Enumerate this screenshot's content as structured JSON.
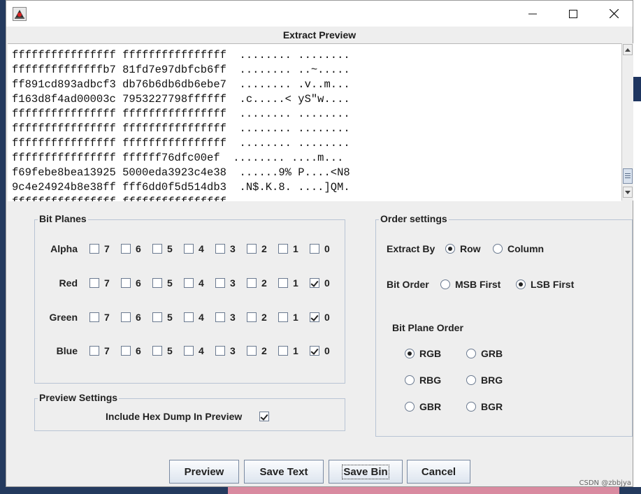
{
  "window": {
    "app_icon": "java-duke-icon",
    "controls": [
      "minimize-icon",
      "maximize-icon",
      "close-icon"
    ],
    "title": "Extract Preview"
  },
  "preview": {
    "lines": [
      "ffffffffffffffff ffffffffffffffff  ........ ........",
      "ffffffffffffffb7 81fd7e97dbfcb6ff  ........ ..~.....",
      "ff891cd893adbcf3 db76b6db6db6ebe7  ........ .v..m...",
      "f163d8f4ad00003c 7953227798ffffff  .c.....< yS\"w....",
      "ffffffffffffffff ffffffffffffffff  ........ ........",
      "ffffffffffffffff ffffffffffffffff  ........ ........",
      "ffffffffffffffff ffffffffffffffff  ........ ........",
      "ffffffffffffffff ffffff76dfc00ef  ........ ....m...",
      "f69febe8bea13925 5000eda3923c4e38  ......9% P....<N8",
      "9c4e24924b8e38ff fff6dd0f5d514db3  .N$.K.8. ....]QM.",
      "ffffffffffffffff ffffffffffffffff  ........ ........"
    ]
  },
  "bit_planes": {
    "title": "Bit Planes",
    "rows": [
      {
        "name": "Alpha",
        "bits": [
          {
            "label": "7",
            "checked": false
          },
          {
            "label": "6",
            "checked": false
          },
          {
            "label": "5",
            "checked": false
          },
          {
            "label": "4",
            "checked": false
          },
          {
            "label": "3",
            "checked": false
          },
          {
            "label": "2",
            "checked": false
          },
          {
            "label": "1",
            "checked": false
          },
          {
            "label": "0",
            "checked": false
          }
        ]
      },
      {
        "name": "Red",
        "bits": [
          {
            "label": "7",
            "checked": false
          },
          {
            "label": "6",
            "checked": false
          },
          {
            "label": "5",
            "checked": false
          },
          {
            "label": "4",
            "checked": false
          },
          {
            "label": "3",
            "checked": false
          },
          {
            "label": "2",
            "checked": false
          },
          {
            "label": "1",
            "checked": false
          },
          {
            "label": "0",
            "checked": true
          }
        ]
      },
      {
        "name": "Green",
        "bits": [
          {
            "label": "7",
            "checked": false
          },
          {
            "label": "6",
            "checked": false
          },
          {
            "label": "5",
            "checked": false
          },
          {
            "label": "4",
            "checked": false
          },
          {
            "label": "3",
            "checked": false
          },
          {
            "label": "2",
            "checked": false
          },
          {
            "label": "1",
            "checked": false
          },
          {
            "label": "0",
            "checked": true
          }
        ]
      },
      {
        "name": "Blue",
        "bits": [
          {
            "label": "7",
            "checked": false
          },
          {
            "label": "6",
            "checked": false
          },
          {
            "label": "5",
            "checked": false
          },
          {
            "label": "4",
            "checked": false
          },
          {
            "label": "3",
            "checked": false
          },
          {
            "label": "2",
            "checked": false
          },
          {
            "label": "1",
            "checked": false
          },
          {
            "label": "0",
            "checked": true
          }
        ]
      }
    ]
  },
  "preview_settings": {
    "title": "Preview Settings",
    "hex_dump_label": "Include Hex Dump In Preview",
    "hex_dump_checked": true
  },
  "order_settings": {
    "title": "Order settings",
    "extract_by": {
      "label": "Extract By",
      "options": [
        "Row",
        "Column"
      ],
      "selected": "Row"
    },
    "bit_order": {
      "label": "Bit Order",
      "options": [
        "MSB First",
        "LSB First"
      ],
      "selected": "LSB First"
    },
    "plane_order": {
      "label": "Bit Plane Order",
      "options": [
        "RGB",
        "GRB",
        "RBG",
        "BRG",
        "GBR",
        "BGR"
      ],
      "selected": "RGB"
    }
  },
  "buttons": {
    "preview": "Preview",
    "save_text": "Save Text",
    "save_bin": "Save Bin",
    "cancel": "Cancel",
    "focused": "save_bin"
  },
  "watermark": "CSDN @zbbjya",
  "colors": {
    "window_bg": "#eeeeee",
    "group_border": "#b8c4d4",
    "button_border": "#7a8aa2",
    "desktop_bg": "#243a5e"
  }
}
